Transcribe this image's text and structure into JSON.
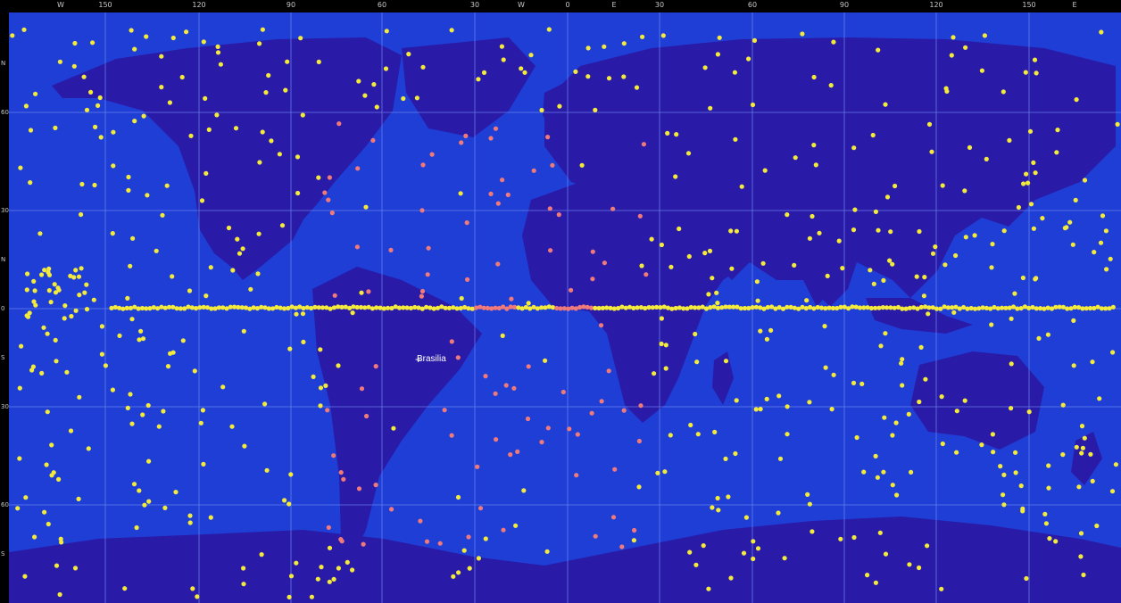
{
  "colors": {
    "ocean": "#1e3ed6",
    "land": "#2a1aa8",
    "grid": "#6f8cf0",
    "sat_day": "#f3ea3c",
    "sat_night": "#f07a7a",
    "label": "#c8c8c8"
  },
  "top_axis": {
    "longitudes": [
      "W",
      "150",
      "120",
      "90",
      "60",
      "30",
      "W",
      "0",
      "E",
      "30",
      "60",
      "90",
      "120",
      "150",
      "E"
    ]
  },
  "left_axis": {
    "labels": [
      "N",
      "60",
      "30",
      "N",
      "0",
      "S",
      "30",
      "60",
      "S"
    ]
  },
  "city": {
    "name": "Brasilia",
    "marker": "+"
  }
}
